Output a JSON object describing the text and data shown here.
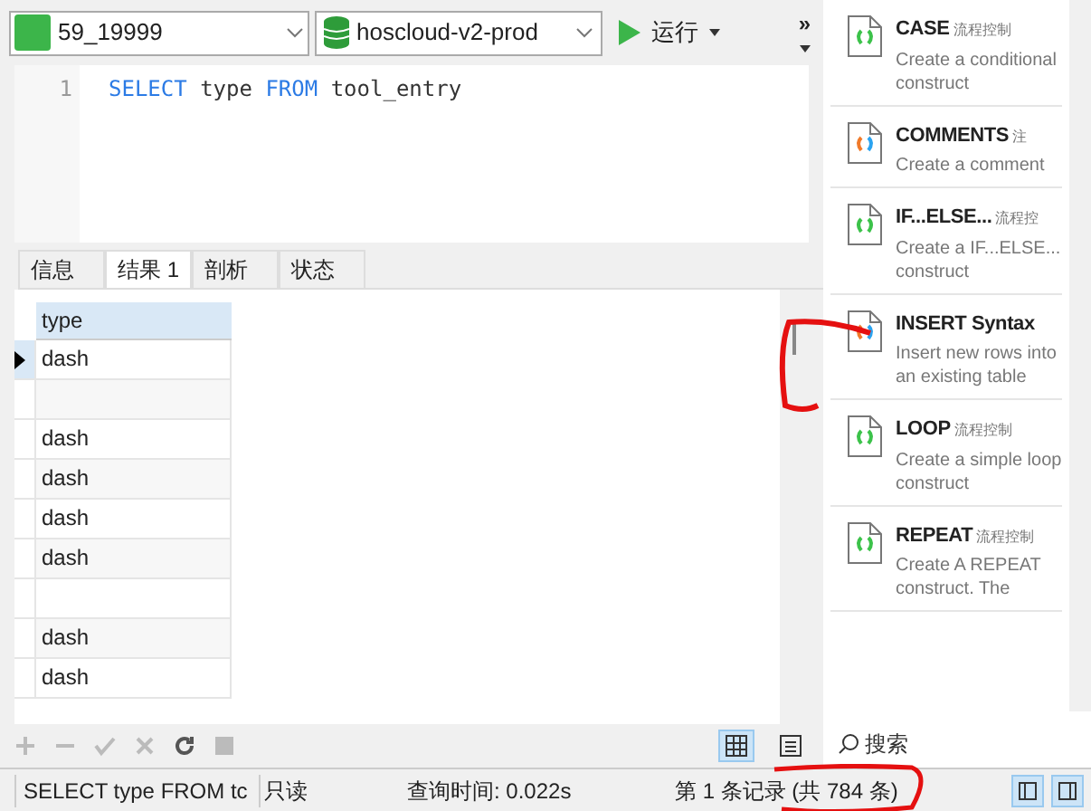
{
  "toolbar": {
    "connection": "59_19999",
    "database": "hoscloud-v2-prod",
    "run_button": "运行",
    "more_button": "»"
  },
  "editor": {
    "lines": [
      {
        "number": "1",
        "tokens": [
          {
            "text": "SELECT",
            "kind": "keyword"
          },
          {
            "text": "type",
            "kind": "plain"
          },
          {
            "text": "FROM",
            "kind": "keyword"
          },
          {
            "text": "tool_entry",
            "kind": "plain"
          }
        ]
      }
    ]
  },
  "result_tabs": [
    {
      "label": "信息",
      "selected": false
    },
    {
      "label": "结果 1",
      "selected": true
    },
    {
      "label": "剖析",
      "selected": false
    },
    {
      "label": "状态",
      "selected": false
    }
  ],
  "table": {
    "columns": [
      "type"
    ],
    "rows": [
      {
        "value": "dash",
        "selected": true
      },
      {
        "selected": false
      },
      {
        "value": "dash",
        "selected": false
      },
      {
        "value": "dash",
        "selected": false
      },
      {
        "value": "dash",
        "selected": false
      },
      {
        "value": "dash",
        "selected": false
      },
      {
        "selected": false
      },
      {
        "value": "dash",
        "selected": false
      },
      {
        "value": "dash",
        "selected": false
      }
    ]
  },
  "grid_view_toggle": {
    "grid_selected": true
  },
  "snippets": [
    {
      "title": "CASE",
      "category": "流程控制",
      "description": "Create a conditional construct",
      "kind": "flow"
    },
    {
      "title": "COMMENTS",
      "category": "注",
      "description": "Create a comment",
      "kind": "syntax"
    },
    {
      "title": "IF...ELSE...",
      "category": "流程控",
      "description": "Create a IF...ELSE... construct",
      "kind": "flow"
    },
    {
      "title": "INSERT Syntax",
      "description": "Insert new rows into an existing table",
      "kind": "syntax"
    },
    {
      "title": "LOOP",
      "category": "流程控制",
      "description": "Create a simple loop construct",
      "kind": "flow"
    },
    {
      "title": "REPEAT",
      "category": "流程控制",
      "description": "Create A REPEAT construct. The",
      "kind": "flow"
    }
  ],
  "snippet_search": {
    "placeholder": "搜索"
  },
  "status_bar": {
    "query": "SELECT type FROM tc",
    "mode": "只读",
    "query_time": "查询时间: 0.022s",
    "record": "第 1 条记录 (共 784 条)"
  }
}
